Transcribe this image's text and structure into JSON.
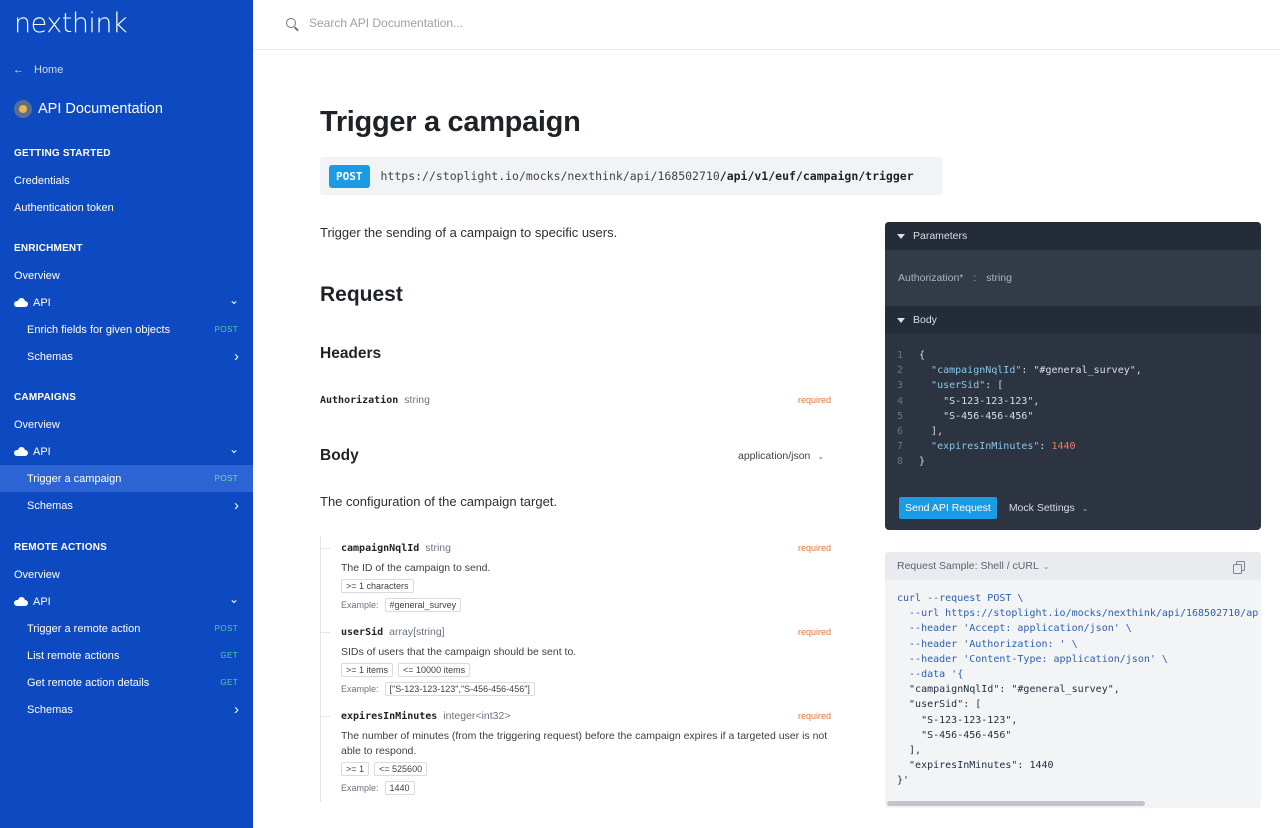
{
  "sidebar": {
    "logo": "nexthink",
    "home": "Home",
    "api_doc": "API Documentation",
    "items": [
      {
        "label": "GETTING STARTED",
        "type": "section"
      },
      {
        "label": "Credentials",
        "type": "item"
      },
      {
        "label": "Authentication token",
        "type": "item"
      },
      {
        "label": "ENRICHMENT",
        "type": "section"
      },
      {
        "label": "Overview",
        "type": "item"
      },
      {
        "label": "API",
        "type": "group"
      },
      {
        "label": "Enrich fields for given objects",
        "type": "sub",
        "badge": "POST"
      },
      {
        "label": "Schemas",
        "type": "sub-folder"
      },
      {
        "label": "CAMPAIGNS",
        "type": "section"
      },
      {
        "label": "Overview",
        "type": "item"
      },
      {
        "label": "API",
        "type": "group"
      },
      {
        "label": "Trigger a campaign",
        "type": "sub",
        "badge": "POST",
        "active": true
      },
      {
        "label": "Schemas",
        "type": "sub-folder"
      },
      {
        "label": "REMOTE ACTIONS",
        "type": "section"
      },
      {
        "label": "Overview",
        "type": "item"
      },
      {
        "label": "API",
        "type": "group"
      },
      {
        "label": "Trigger a remote action",
        "type": "sub",
        "badge": "POST"
      },
      {
        "label": "List remote actions",
        "type": "sub",
        "badge": "GET"
      },
      {
        "label": "Get remote action details",
        "type": "sub",
        "badge": "GET"
      },
      {
        "label": "Schemas",
        "type": "sub-folder"
      }
    ]
  },
  "search": {
    "placeholder": "Search API Documentation..."
  },
  "main": {
    "title": "Trigger a campaign",
    "method": "POST",
    "url_prefix": "https://stoplight.io/mocks/nexthink/api/168502710",
    "url_path": "/api/v1/euf/campaign/trigger",
    "description": "Trigger the sending of a campaign to specific users.",
    "request_title": "Request",
    "headers_title": "Headers",
    "header": {
      "name": "Authorization",
      "type": "string",
      "required": "required"
    },
    "body_title": "Body",
    "media_type": "application/json",
    "body_description": "The configuration of the campaign target.",
    "example_label": "Example:",
    "fields": [
      {
        "name": "campaignNqlId",
        "type": "string",
        "required": "required",
        "description": "The ID of the campaign to send.",
        "chips": [
          ">= 1 characters"
        ],
        "example": "#general_survey"
      },
      {
        "name": "userSid",
        "type": "array[string]",
        "required": "required",
        "description": "SIDs of users that the campaign should be sent to.",
        "chips": [
          ">= 1 items",
          "<= 10000 items"
        ],
        "example": "[\"S-123-123-123\",\"S-456-456-456\"]"
      },
      {
        "name": "expiresInMinutes",
        "type": "integer<int32>",
        "required": "required",
        "description": "The number of minutes (from the triggering request) before the campaign expires if a targeted user is not able to respond.",
        "chips": [
          ">= 1",
          "<= 525600"
        ],
        "example": "1440"
      }
    ]
  },
  "panel": {
    "parameters_title": "Parameters",
    "param_name": "Authorization*",
    "param_sep": ":",
    "param_type": "string",
    "body_title": "Body",
    "code_lines": [
      {
        "n": "1",
        "parts": [
          [
            "cl",
            "{"
          ]
        ]
      },
      {
        "n": "2",
        "parts": [
          [
            "cl",
            "  "
          ],
          [
            "k",
            "\"campaignNqlId\""
          ],
          [
            "cl",
            ": "
          ],
          [
            "s",
            "\"#general_survey\""
          ],
          [
            "cl",
            ","
          ]
        ]
      },
      {
        "n": "3",
        "parts": [
          [
            "cl",
            "  "
          ],
          [
            "k",
            "\"userSid\""
          ],
          [
            "cl",
            ": ["
          ]
        ]
      },
      {
        "n": "4",
        "parts": [
          [
            "cl",
            "    "
          ],
          [
            "s",
            "\"S-123-123-123\""
          ],
          [
            "cl",
            ","
          ]
        ]
      },
      {
        "n": "5",
        "parts": [
          [
            "cl",
            "    "
          ],
          [
            "s",
            "\"S-456-456-456\""
          ]
        ]
      },
      {
        "n": "6",
        "parts": [
          [
            "cl",
            "  ],"
          ]
        ]
      },
      {
        "n": "7",
        "parts": [
          [
            "cl",
            "  "
          ],
          [
            "k",
            "\"expiresInMinutes\""
          ],
          [
            "cl",
            ": "
          ],
          [
            "n",
            "1440"
          ]
        ]
      },
      {
        "n": "8",
        "parts": [
          [
            "cl",
            "}"
          ]
        ]
      }
    ],
    "send_button": "Send API Request",
    "mock_settings": "Mock Settings"
  },
  "sample": {
    "title": "Request Sample: Shell / cURL",
    "lines": [
      "curl --request POST \\",
      "  --url https://stoplight.io/mocks/nexthink/api/168502710/ap",
      "  --header 'Accept: application/json' \\",
      "  --header 'Authorization: ' \\",
      "  --header 'Content-Type: application/json' \\",
      "  --data '{",
      "  \"campaignNqlId\": \"#general_survey\",",
      "  \"userSid\": [",
      "    \"S-123-123-123\",",
      "    \"S-456-456-456\"",
      "  ],",
      "  \"expiresInMinutes\": 1440",
      "}'"
    ]
  },
  "colors": {
    "sidebar": "#0d49c0",
    "post": "#1a9be6",
    "required": "#e2733c",
    "panel": "#2b3440"
  }
}
